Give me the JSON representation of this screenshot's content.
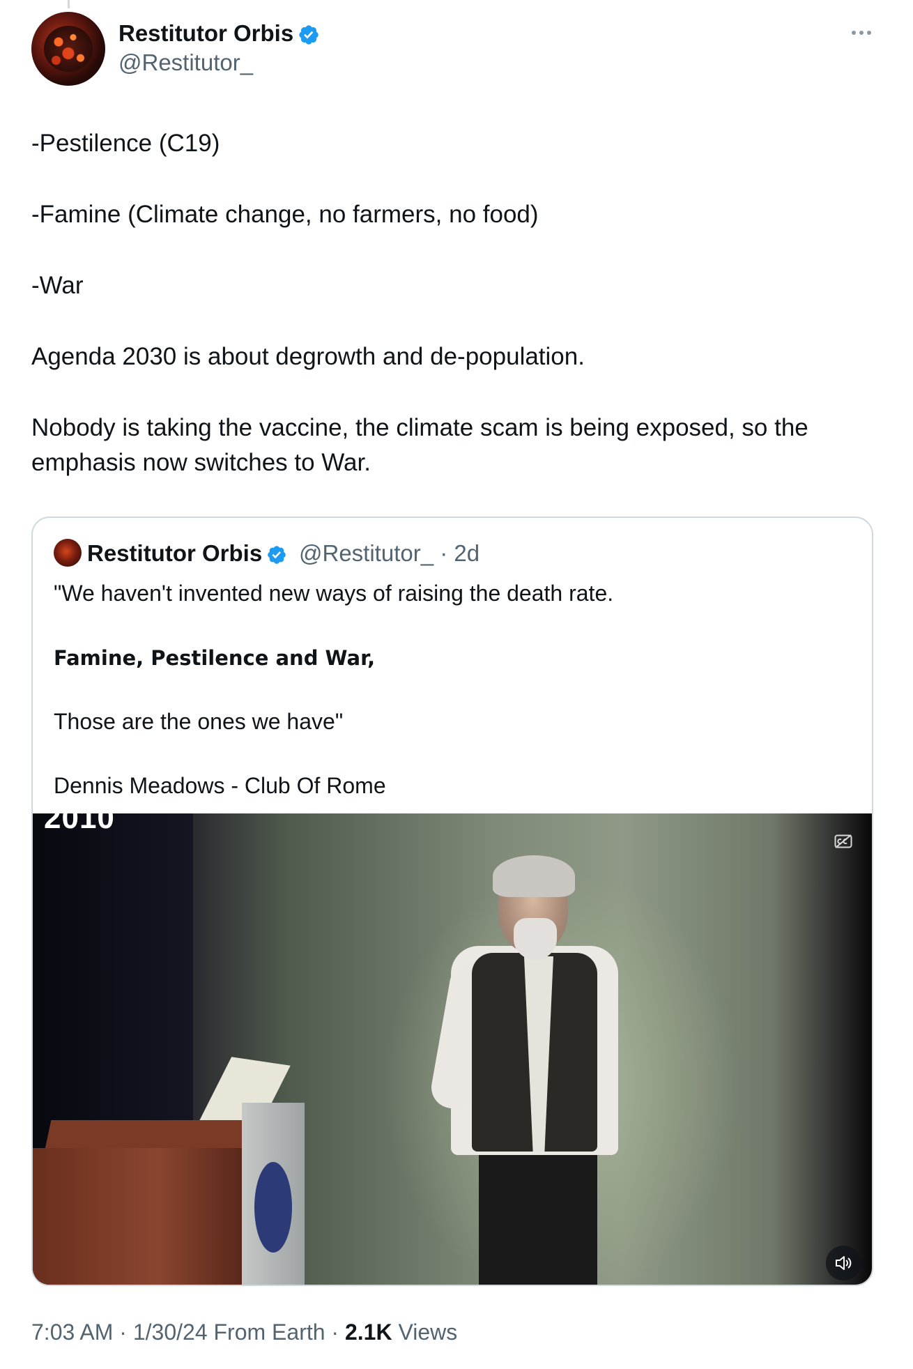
{
  "author": {
    "display_name": "Restitutor Orbis",
    "handle": "@Restitutor_"
  },
  "tweet": {
    "lines": [
      "-Pestilence (C19)",
      "-Famine (Climate change, no farmers, no food)",
      "-War",
      "Agenda 2030 is about degrowth and de-population.",
      "Nobody is taking the vaccine, the climate scam is being exposed, so the",
      "emphasis now switches to War."
    ]
  },
  "quote": {
    "display_name": "Restitutor Orbis",
    "handle_time": "@Restitutor_ · 2d",
    "line1": "\"We haven't invented new ways of raising the death rate.",
    "bold_famine": "Famine",
    "comma1": ", ",
    "bold_rest": "Pestilence and War",
    "comma2": ",",
    "line3": "Those are the ones we have\"",
    "line4": "Dennis Meadows - Club Of Rome",
    "video": {
      "overlay_text": "2010"
    }
  },
  "meta": {
    "time_date": "7:03 AM · 1/30/24 From Earth · ",
    "views_count": "2.1K",
    "views_label": " Views"
  },
  "icons": {
    "verified": "verified-badge-icon",
    "more": "more-options-icon",
    "captions": "captions-icon",
    "volume": "volume-icon"
  },
  "colors": {
    "verified_blue": "#1d9bf0",
    "text_primary": "#0f1419",
    "text_secondary": "#536471",
    "border": "#cfd9de"
  }
}
